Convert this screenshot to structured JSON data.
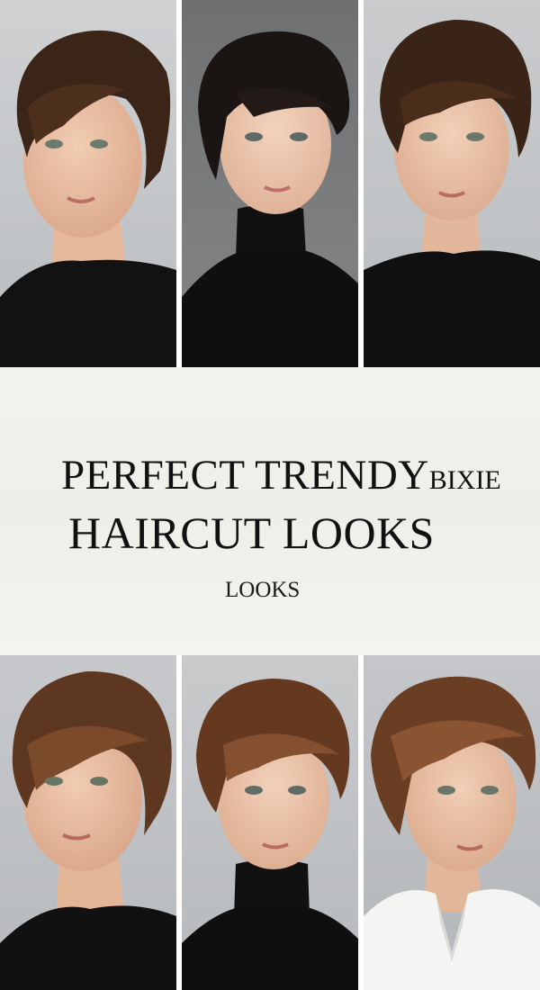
{
  "title": {
    "line1_main": "PERFECT TRENDY",
    "line1_overflow": "BIXIE",
    "line2": "HAIRCUT LOOKS",
    "line3": "LOOKS"
  },
  "colors": {
    "panel_background": "#f2f2ee",
    "title_text": "#111111",
    "hair_dark_brown": "#3b2418",
    "hair_black": "#1a1413",
    "hair_chestnut": "#6a3e22",
    "sweater_black": "#111111",
    "shirt_white": "#f4f4f2"
  },
  "photos_top": [
    {
      "name": "portrait-top-left",
      "hair": "dark-brown pixie",
      "top": "black sweater"
    },
    {
      "name": "portrait-top-middle",
      "hair": "black pixie",
      "top": "black turtleneck"
    },
    {
      "name": "portrait-top-right",
      "hair": "dark-brown pixie",
      "top": "black sweater"
    }
  ],
  "photos_bottom": [
    {
      "name": "portrait-bottom-left",
      "hair": "chestnut pixie",
      "top": "black sweater"
    },
    {
      "name": "portrait-bottom-middle",
      "hair": "chestnut pixie",
      "top": "black turtleneck"
    },
    {
      "name": "portrait-bottom-right",
      "hair": "chestnut pixie",
      "top": "white collared shirt"
    }
  ]
}
